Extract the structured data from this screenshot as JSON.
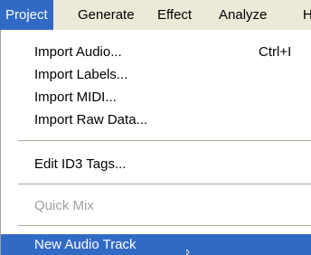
{
  "menubar": {
    "items": [
      {
        "label": "Project"
      },
      {
        "label": "Generate"
      },
      {
        "label": "Effect"
      },
      {
        "label": "Analyze"
      },
      {
        "label": "H"
      }
    ]
  },
  "dropdown": {
    "import_audio": {
      "label": "Import Audio...",
      "shortcut": "Ctrl+I"
    },
    "import_labels": {
      "label": "Import Labels..."
    },
    "import_midi": {
      "label": "Import MIDI..."
    },
    "import_raw": {
      "label": "Import Raw Data..."
    },
    "edit_id3": {
      "label": "Edit ID3 Tags..."
    },
    "quick_mix": {
      "label": "Quick Mix",
      "state": "disabled"
    },
    "new_audio_track": {
      "label": "New Audio Track",
      "state": "highlighted"
    }
  },
  "colors": {
    "menubar_bg": "#ece9d8",
    "highlight": "#316ac5",
    "disabled_text": "#a0a0a0"
  },
  "icons": {
    "cursor": "mouse-pointer-icon"
  }
}
